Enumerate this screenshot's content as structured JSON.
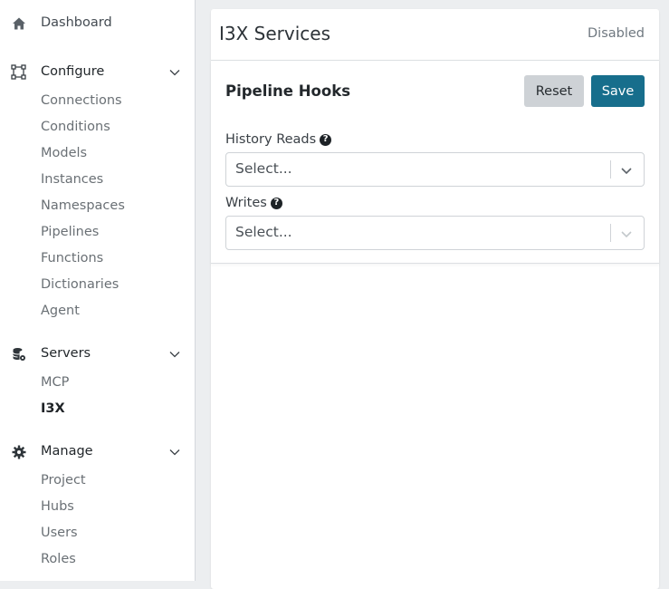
{
  "sidebar": {
    "dashboard": {
      "label": "Dashboard",
      "icon": "home-icon"
    },
    "configure": {
      "label": "Configure",
      "icon": "nodes-icon",
      "items": [
        "Connections",
        "Conditions",
        "Models",
        "Instances",
        "Namespaces",
        "Pipelines",
        "Functions",
        "Dictionaries",
        "Agent"
      ]
    },
    "servers": {
      "label": "Servers",
      "icon": "database-gear-icon",
      "items": [
        "MCP",
        "I3X"
      ],
      "active": "I3X"
    },
    "manage": {
      "label": "Manage",
      "icon": "gear-icon",
      "items": [
        "Project",
        "Hubs",
        "Users",
        "Roles"
      ]
    }
  },
  "main": {
    "title": "I3X Services",
    "status": "Disabled",
    "section": {
      "title": "Pipeline Hooks",
      "reset_label": "Reset",
      "save_label": "Save",
      "fields": [
        {
          "label": "History Reads",
          "placeholder": "Select..."
        },
        {
          "label": "Writes",
          "placeholder": "Select..."
        }
      ]
    }
  },
  "colors": {
    "primary": "#176e8c",
    "reset_bg": "#ced2d6",
    "page_bg": "#eceef0"
  }
}
